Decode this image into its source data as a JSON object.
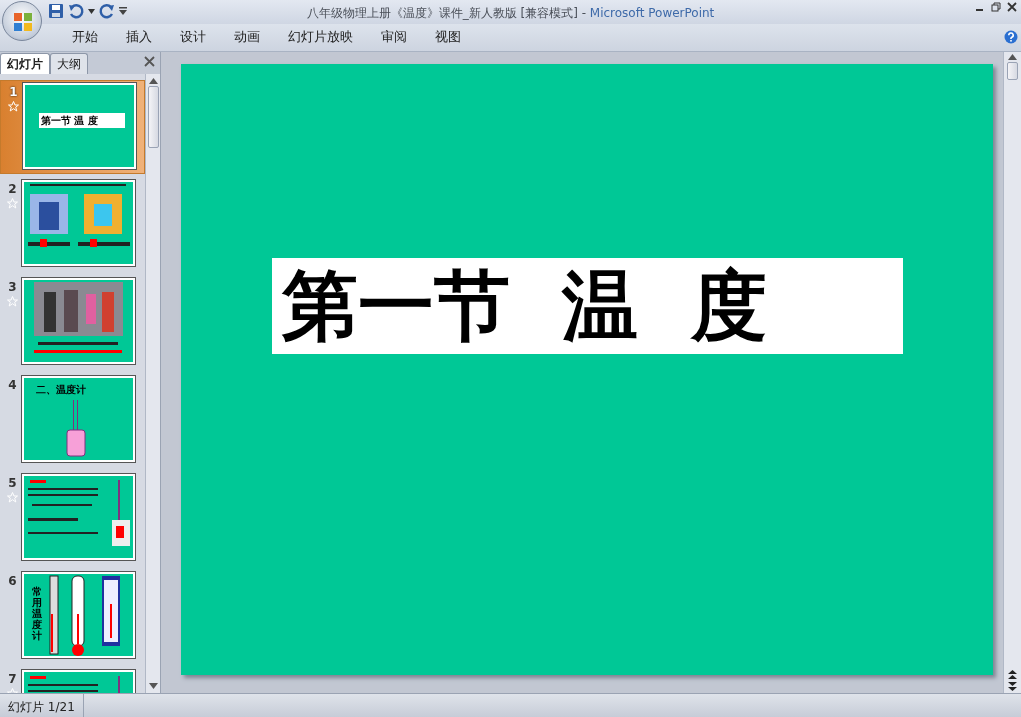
{
  "window": {
    "title": "八年级物理上册《温度》课件_新人教版 [兼容模式]",
    "separator": "-",
    "app_name": "Microsoft PowerPoint"
  },
  "ribbon_tabs": [
    "开始",
    "插入",
    "设计",
    "动画",
    "幻灯片放映",
    "审阅",
    "视图"
  ],
  "panel_tabs": [
    {
      "label": "幻灯片",
      "selected": true
    },
    {
      "label": "大纲",
      "selected": false
    }
  ],
  "slides": [
    {
      "number": "1",
      "selected": true,
      "animated": true,
      "kind": "title",
      "heading": "第一节 温 度"
    },
    {
      "number": "2",
      "selected": false,
      "animated": true,
      "kind": "cartoons"
    },
    {
      "number": "3",
      "selected": false,
      "animated": true,
      "kind": "photo"
    },
    {
      "number": "4",
      "selected": false,
      "animated": false,
      "kind": "diagram",
      "heading": "二、温度计"
    },
    {
      "number": "5",
      "selected": false,
      "animated": true,
      "kind": "text"
    },
    {
      "number": "6",
      "selected": false,
      "animated": false,
      "kind": "thermometers",
      "heading": "常用温度计"
    },
    {
      "number": "7",
      "selected": false,
      "animated": true,
      "kind": "text"
    }
  ],
  "current_slide": {
    "title": "第一节  温  度"
  },
  "status_bar": {
    "slide_indicator": "幻灯片 1/21"
  }
}
